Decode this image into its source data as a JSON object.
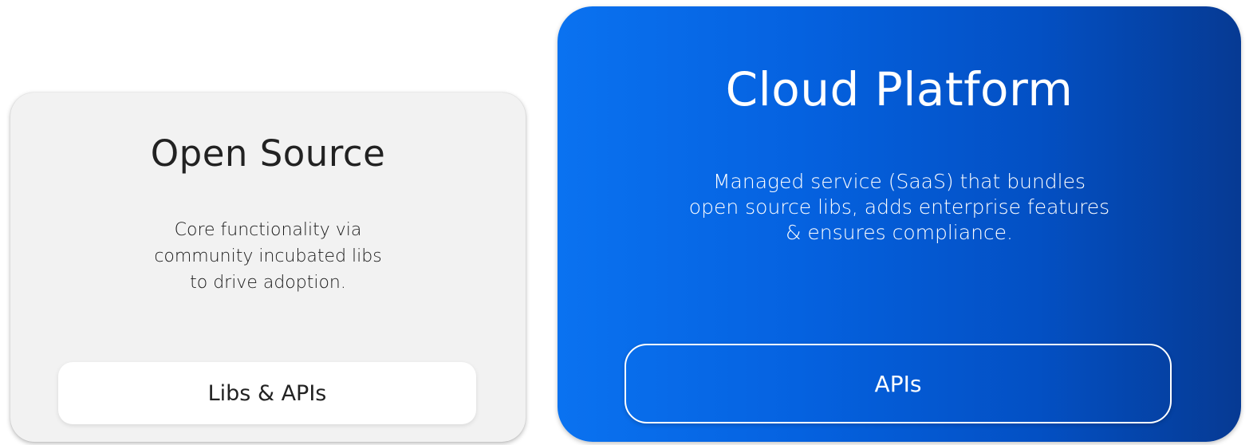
{
  "open_source": {
    "title": "Open Source",
    "description_lines": [
      "Core functionality via",
      "community incubated libs",
      "to drive adoption."
    ],
    "pill_label": "Libs & APIs",
    "colors": {
      "card_bg": "#f2f2f2",
      "text": "#222222",
      "pill_bg": "#ffffff"
    }
  },
  "cloud_platform": {
    "title": "Cloud Platform",
    "description_lines": [
      "Managed service (SaaS) that bundles",
      "open source libs, adds enterprise features",
      "& ensures compliance."
    ],
    "pill_label": "APIs",
    "colors": {
      "gradient_start": "#0a72f0",
      "gradient_end": "#063a93",
      "text": "#ffffff"
    }
  }
}
